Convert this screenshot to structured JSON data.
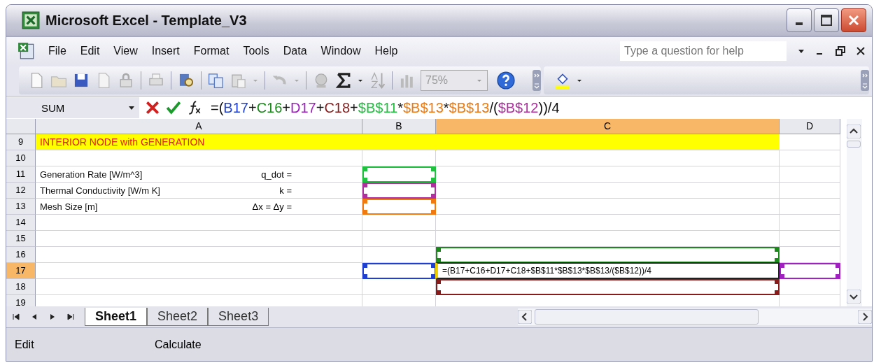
{
  "window": {
    "title": "Microsoft Excel - Template_V3"
  },
  "menu": [
    {
      "label": "File"
    },
    {
      "label": "Edit"
    },
    {
      "label": "View"
    },
    {
      "label": "Insert"
    },
    {
      "label": "Format"
    },
    {
      "label": "Tools"
    },
    {
      "label": "Data"
    },
    {
      "label": "Window"
    },
    {
      "label": "Help"
    }
  ],
  "help_search": {
    "placeholder": "Type a question for help"
  },
  "toolbar": {
    "zoom": "75%"
  },
  "formula_bar": {
    "name_box": "SUM",
    "parts": [
      {
        "text": "=("
      },
      {
        "text": "B17",
        "color": "#1f3fd0"
      },
      {
        "text": "+"
      },
      {
        "text": "C16",
        "color": "#1a8a1a"
      },
      {
        "text": "+"
      },
      {
        "text": "D17",
        "color": "#a020c0"
      },
      {
        "text": "+"
      },
      {
        "text": "C18",
        "color": "#8b1a1a"
      },
      {
        "text": "+"
      },
      {
        "text": "$B$11",
        "color": "#22c040"
      },
      {
        "text": "*"
      },
      {
        "text": "$B$13",
        "color": "#f07a10"
      },
      {
        "text": "*"
      },
      {
        "text": "$B$13",
        "color": "#f07a10"
      },
      {
        "text": "/("
      },
      {
        "text": "$B$12",
        "color": "#b030a0"
      },
      {
        "text": "))/4"
      }
    ]
  },
  "columns": [
    {
      "label": "A",
      "selected": false
    },
    {
      "label": "B",
      "selected": false
    },
    {
      "label": "C",
      "selected": true
    },
    {
      "label": "D",
      "selected": false
    }
  ],
  "rows": [
    {
      "header": "9",
      "selected": false,
      "cells": [
        {
          "text": "INTERIOR NODE with GENERATION",
          "highlighted": true
        },
        {
          "highlighted": true
        },
        {
          "highlighted": true
        },
        {}
      ]
    },
    {
      "header": "10",
      "selected": false,
      "cells": [
        {},
        {},
        {},
        {}
      ]
    },
    {
      "header": "11",
      "selected": false,
      "cells": [
        {
          "text": "Generation Rate [W/m^3]",
          "note": "q_dot ="
        },
        {
          "color": "#22c040"
        },
        {},
        {}
      ]
    },
    {
      "header": "12",
      "selected": false,
      "cells": [
        {
          "text": "Thermal Conductivity [W/m K]",
          "note": "k ="
        },
        {
          "color": "#b030a0"
        },
        {},
        {}
      ]
    },
    {
      "header": "13",
      "selected": false,
      "cells": [
        {
          "text": "Mesh Size [m]",
          "note": "Δx = Δy ="
        },
        {
          "color": "#f07a10"
        },
        {},
        {}
      ]
    },
    {
      "header": "14",
      "selected": false,
      "cells": [
        {},
        {},
        {},
        {}
      ]
    },
    {
      "header": "15",
      "selected": false,
      "cells": [
        {},
        {},
        {},
        {}
      ]
    },
    {
      "header": "16",
      "selected": false,
      "cells": [
        {},
        {},
        {
          "color": "#1a8a1a"
        },
        {}
      ]
    },
    {
      "header": "17",
      "selected": true,
      "cells": [
        {},
        {
          "color": "#1f3fd0"
        },
        {
          "value": "=(B17+C16+D17+C18+$B$11*$B$13*$B$13/($B$12))/4",
          "active": true
        },
        {
          "color": "#a020c0"
        }
      ]
    },
    {
      "header": "18",
      "selected": false,
      "cells": [
        {},
        {},
        {
          "color": "#8b1a1a"
        },
        {}
      ]
    },
    {
      "header": "19",
      "selected": false,
      "cells": [
        {},
        {},
        {},
        {}
      ]
    }
  ],
  "sheet_tabs": [
    {
      "label": "Sheet1",
      "selected": true
    },
    {
      "label": "Sheet2",
      "selected": false
    },
    {
      "label": "Sheet3",
      "selected": false
    }
  ],
  "status_bar": {
    "mode": "Edit",
    "message": "Calculate"
  }
}
